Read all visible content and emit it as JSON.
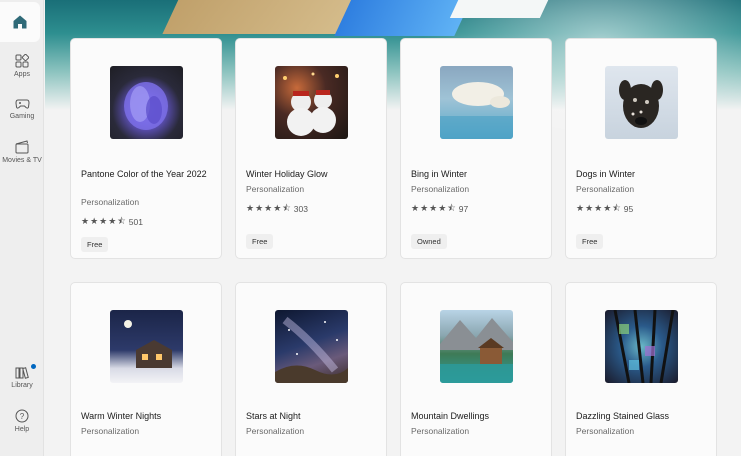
{
  "sidebar": {
    "items": [
      {
        "label": "Apps"
      },
      {
        "label": "Gaming"
      },
      {
        "label": "Movies & TV"
      },
      {
        "label": "Library"
      },
      {
        "label": "Help"
      }
    ]
  },
  "cards": [
    {
      "title": "Pantone Color of the Year 2022",
      "category": "Personalization",
      "stars": "★★★★⯪",
      "count": "501",
      "badge": "Free"
    },
    {
      "title": "Winter Holiday Glow",
      "category": "Personalization",
      "stars": "★★★★⯪",
      "count": "303",
      "badge": "Free"
    },
    {
      "title": "Bing in Winter",
      "category": "Personalization",
      "stars": "★★★★⯪",
      "count": "97",
      "badge": "Owned"
    },
    {
      "title": "Dogs in Winter",
      "category": "Personalization",
      "stars": "★★★★⯪",
      "count": "95",
      "badge": "Free"
    },
    {
      "title": "Warm Winter Nights",
      "category": "Personalization"
    },
    {
      "title": "Stars at Night",
      "category": "Personalization"
    },
    {
      "title": "Mountain Dwellings",
      "category": "Personalization"
    },
    {
      "title": "Dazzling Stained Glass",
      "category": "Personalization"
    }
  ]
}
